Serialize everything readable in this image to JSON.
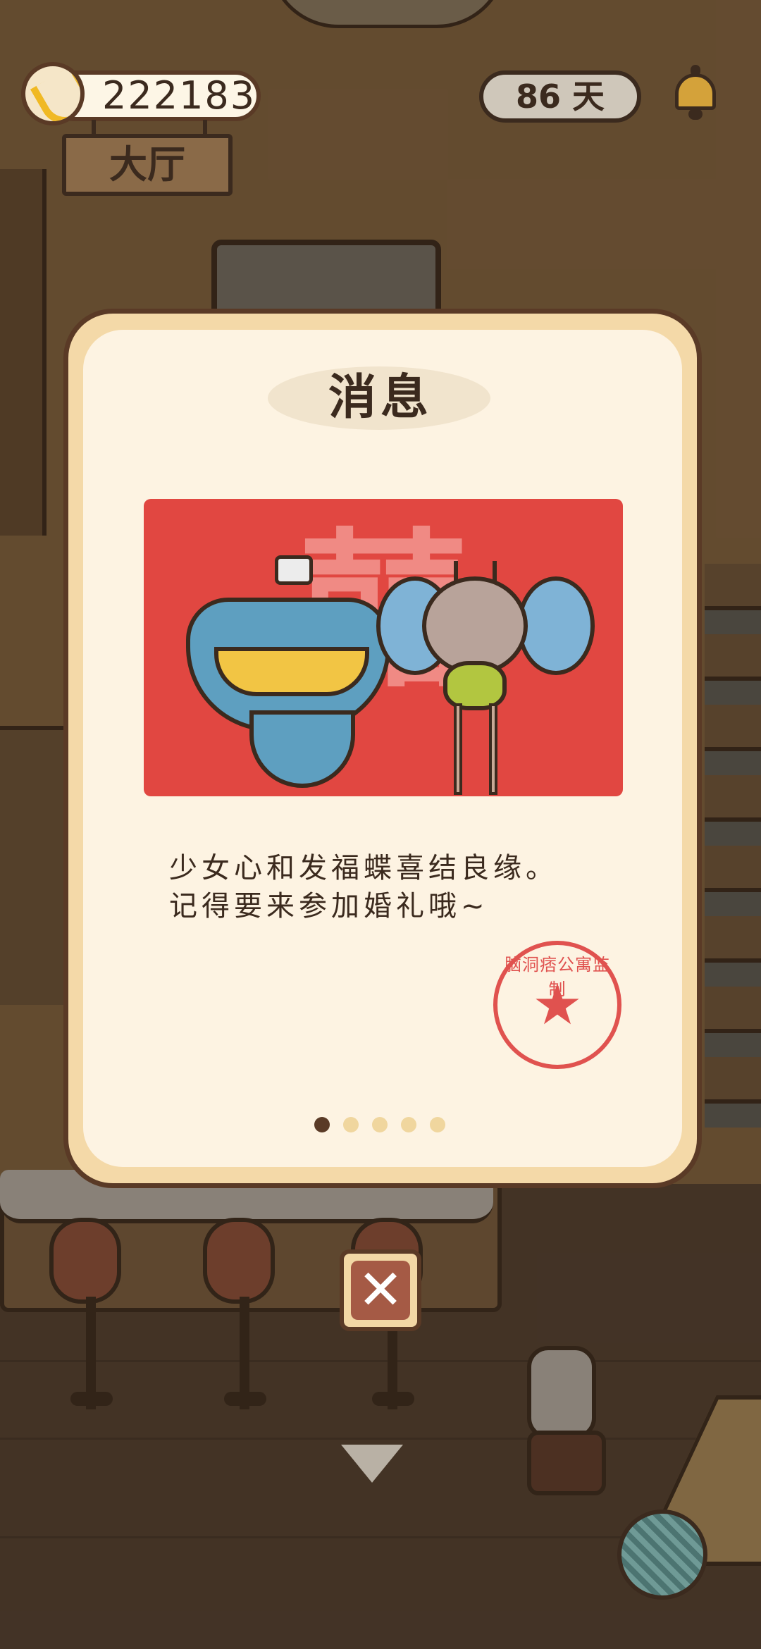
{
  "hud": {
    "coins": "222183",
    "days": "86 天",
    "room_name": "大厅",
    "bell_icon": "bell-icon",
    "banana_icon": "banana-icon"
  },
  "modal": {
    "title": "消息",
    "illustration_character": "囍",
    "message_lines": [
      "少女心和发福蝶喜结良缘。",
      "记得要来参加婚礼哦~"
    ],
    "stamp_text": "脑洞痞公寓监制",
    "stamp_star": "★",
    "page_indicator": {
      "total": 5,
      "current": 1
    },
    "close_label": "✕"
  },
  "colors": {
    "accent_red": "#e14741",
    "stamp_red": "#e0524f",
    "modal_bg": "#fdf3e2",
    "frame": "#f4d9a8",
    "dark_brown": "#3b2a1e"
  }
}
